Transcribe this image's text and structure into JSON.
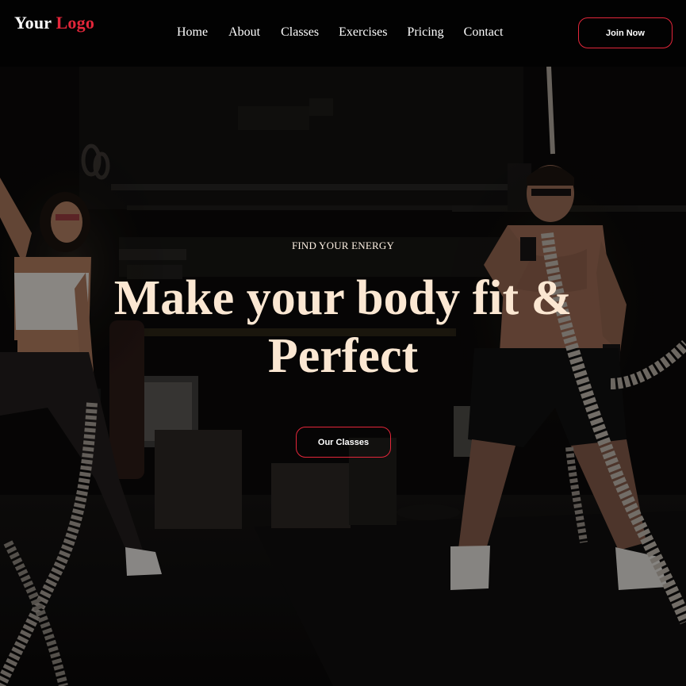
{
  "navbar": {
    "logo": {
      "part1": "Your",
      "part2": "Logo"
    },
    "links": [
      {
        "label": "Home"
      },
      {
        "label": "About"
      },
      {
        "label": "Classes"
      },
      {
        "label": "Exercises"
      },
      {
        "label": "Pricing"
      },
      {
        "label": "Contact"
      }
    ],
    "cta_label": "Join Now"
  },
  "hero": {
    "eyebrow": "FIND YOUR ENERGY",
    "headline": "Make your body fit & Perfect",
    "cta_label": "Our Classes",
    "background_image": "gym-battle-ropes-photo"
  },
  "colors": {
    "accent": "#e3263a",
    "headline": "#fbe7d2",
    "navbar_bg": "#020202",
    "text": "#ffffff"
  }
}
